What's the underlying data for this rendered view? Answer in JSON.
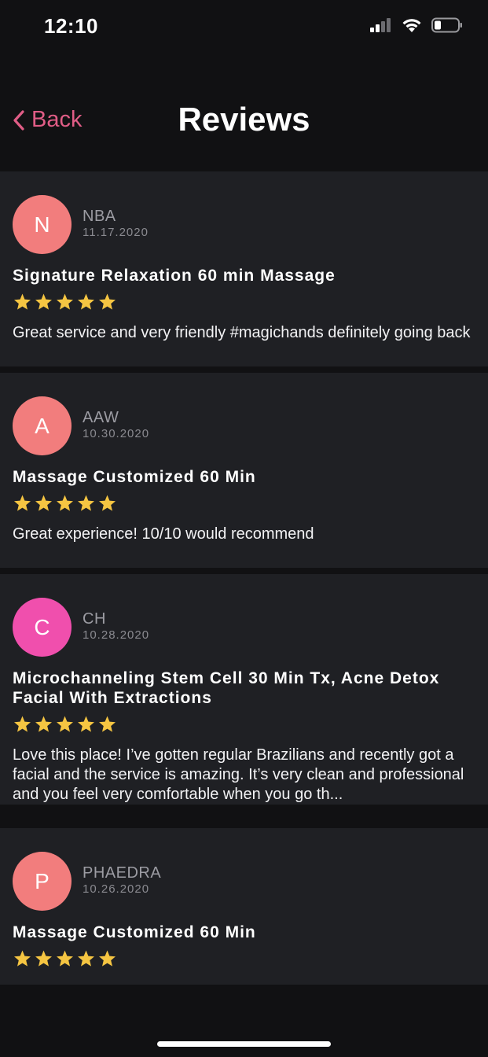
{
  "status_bar": {
    "time": "12:10",
    "icons": [
      "cellular-signal-icon",
      "wifi-icon",
      "battery-icon"
    ]
  },
  "nav": {
    "back_label": "Back",
    "title": "Reviews"
  },
  "colors": {
    "accent": "#e05d86",
    "star": "#f5c542",
    "avatar_salmon": "#f27d7d",
    "avatar_pink": "#f04fad",
    "card_bg": "#1f2024",
    "page_bg": "#111113"
  },
  "reviews": [
    {
      "initial": "N",
      "name": "NBA",
      "date": "11.17.2020",
      "service": "Signature Relaxation 60 min Massage",
      "rating": 5,
      "text": "Great service and very friendly #magichands definitely going back"
    },
    {
      "initial": "A",
      "name": "AAW",
      "date": "10.30.2020",
      "service": "Massage Customized 60 Min",
      "rating": 5,
      "text": "Great experience! 10/10 would recommend"
    },
    {
      "initial": "C",
      "name": "CH",
      "date": "10.28.2020",
      "service": "Microchanneling Stem Cell 30 Min Tx, Acne Detox Facial With Extractions",
      "rating": 5,
      "text": "Love this place! I’ve gotten regular Brazilians and recently got a facial and the service is amazing. It’s very clean and professional and you feel very comfortable when you go th..."
    },
    {
      "initial": "P",
      "name": "PHAEDRA",
      "date": "10.26.2020",
      "service": "Massage Customized 60 Min",
      "rating": 5,
      "text": ""
    }
  ]
}
